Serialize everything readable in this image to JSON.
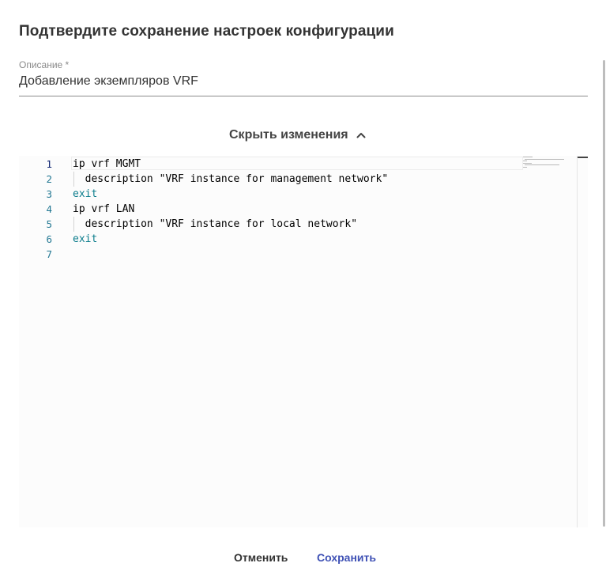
{
  "dialog": {
    "title": "Подтвердите сохранение настроек конфигурации"
  },
  "description_field": {
    "label": "Описание *",
    "value": "Добавление экземпляров VRF"
  },
  "changes_toggle": {
    "label": "Скрыть изменения",
    "icon": "chevron-up-icon"
  },
  "editor": {
    "lines": [
      {
        "number": "1",
        "text": "ip vrf MGMT"
      },
      {
        "number": "2",
        "text": "  description \"VRF instance for management network\""
      },
      {
        "number": "3",
        "text": "exit"
      },
      {
        "number": "4",
        "text": "ip vrf LAN"
      },
      {
        "number": "5",
        "text": "  description \"VRF instance for local network\""
      },
      {
        "number": "6",
        "text": "exit"
      },
      {
        "number": "7",
        "text": ""
      }
    ],
    "colors": {
      "line_number": "#237893",
      "keyword": "#0c7d8c",
      "text": "#000000"
    }
  },
  "actions": {
    "cancel_label": "Отменить",
    "save_label": "Сохранить",
    "accent_color": "#3f51b5"
  }
}
